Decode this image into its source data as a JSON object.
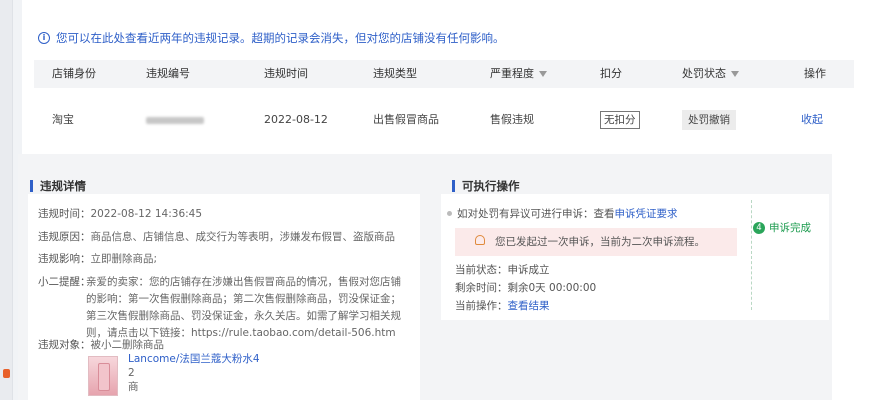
{
  "notice": {
    "icon": "info-icon",
    "text": "您可以在此处查看近两年的违规记录。超期的记录会消失，但对您的店铺没有任何影响。"
  },
  "table": {
    "columns": [
      "店铺身份",
      "违规编号",
      "违规时间",
      "违规类型",
      "严重程度",
      "扣分",
      "处罚状态",
      "操作"
    ],
    "row": {
      "shop": "淘宝",
      "id_blurred": "",
      "time": "2022-08-12",
      "type": "出售假冒商品",
      "severity": "售假违规",
      "points": "无扣分",
      "status": "处罚撤销",
      "action": "收起"
    }
  },
  "detail": {
    "title": "违规详情",
    "time_label": "违规时间：",
    "time_value": "2022-08-12 14:36:45",
    "reason_label": "违规原因：",
    "reason_value": "商品信息、店铺信息、成交行为等表明，涉嫌发布假冒、盗版商品",
    "impact_label": "违规影响：",
    "impact_value": "立即删除商品;",
    "tip_label": "小二提醒：",
    "tip_value": "亲爱的卖家：您的店铺存在涉嫌出售假冒商品的情况，售假对您店铺的影响：第一次售假删除商品；第二次售假删除商品，罚没保证金；第三次售假删除商品、罚没保证金，永久关店。如需了解学习相关规则，请点击以下链接：https://rule.taobao.com/detail-506.htm",
    "object_label": "违规对象：",
    "object_value": "被小二删除商品",
    "product_name": "Lancome/法国兰蔻大粉水4",
    "product_line2": "2",
    "product_line3": "商"
  },
  "actions": {
    "title": "可执行操作",
    "appeal_prompt": "如对处罚有异议可进行申诉：查看",
    "appeal_link": "申诉凭证要求",
    "warning": "您已发起过一次申诉，当前为二次申诉流程。",
    "status_label": "当前状态：",
    "status_value": "申诉成立",
    "remain_label": "剩余时间：",
    "remain_value": "剩余0天 00:00:00",
    "op_label": "当前操作：",
    "op_link": "查看结果",
    "step_num": "4",
    "step_label": "申诉完成"
  },
  "colors": {
    "accent": "#2e5fc8",
    "success": "#2aa55a",
    "warning_bg": "#fbeaea"
  }
}
